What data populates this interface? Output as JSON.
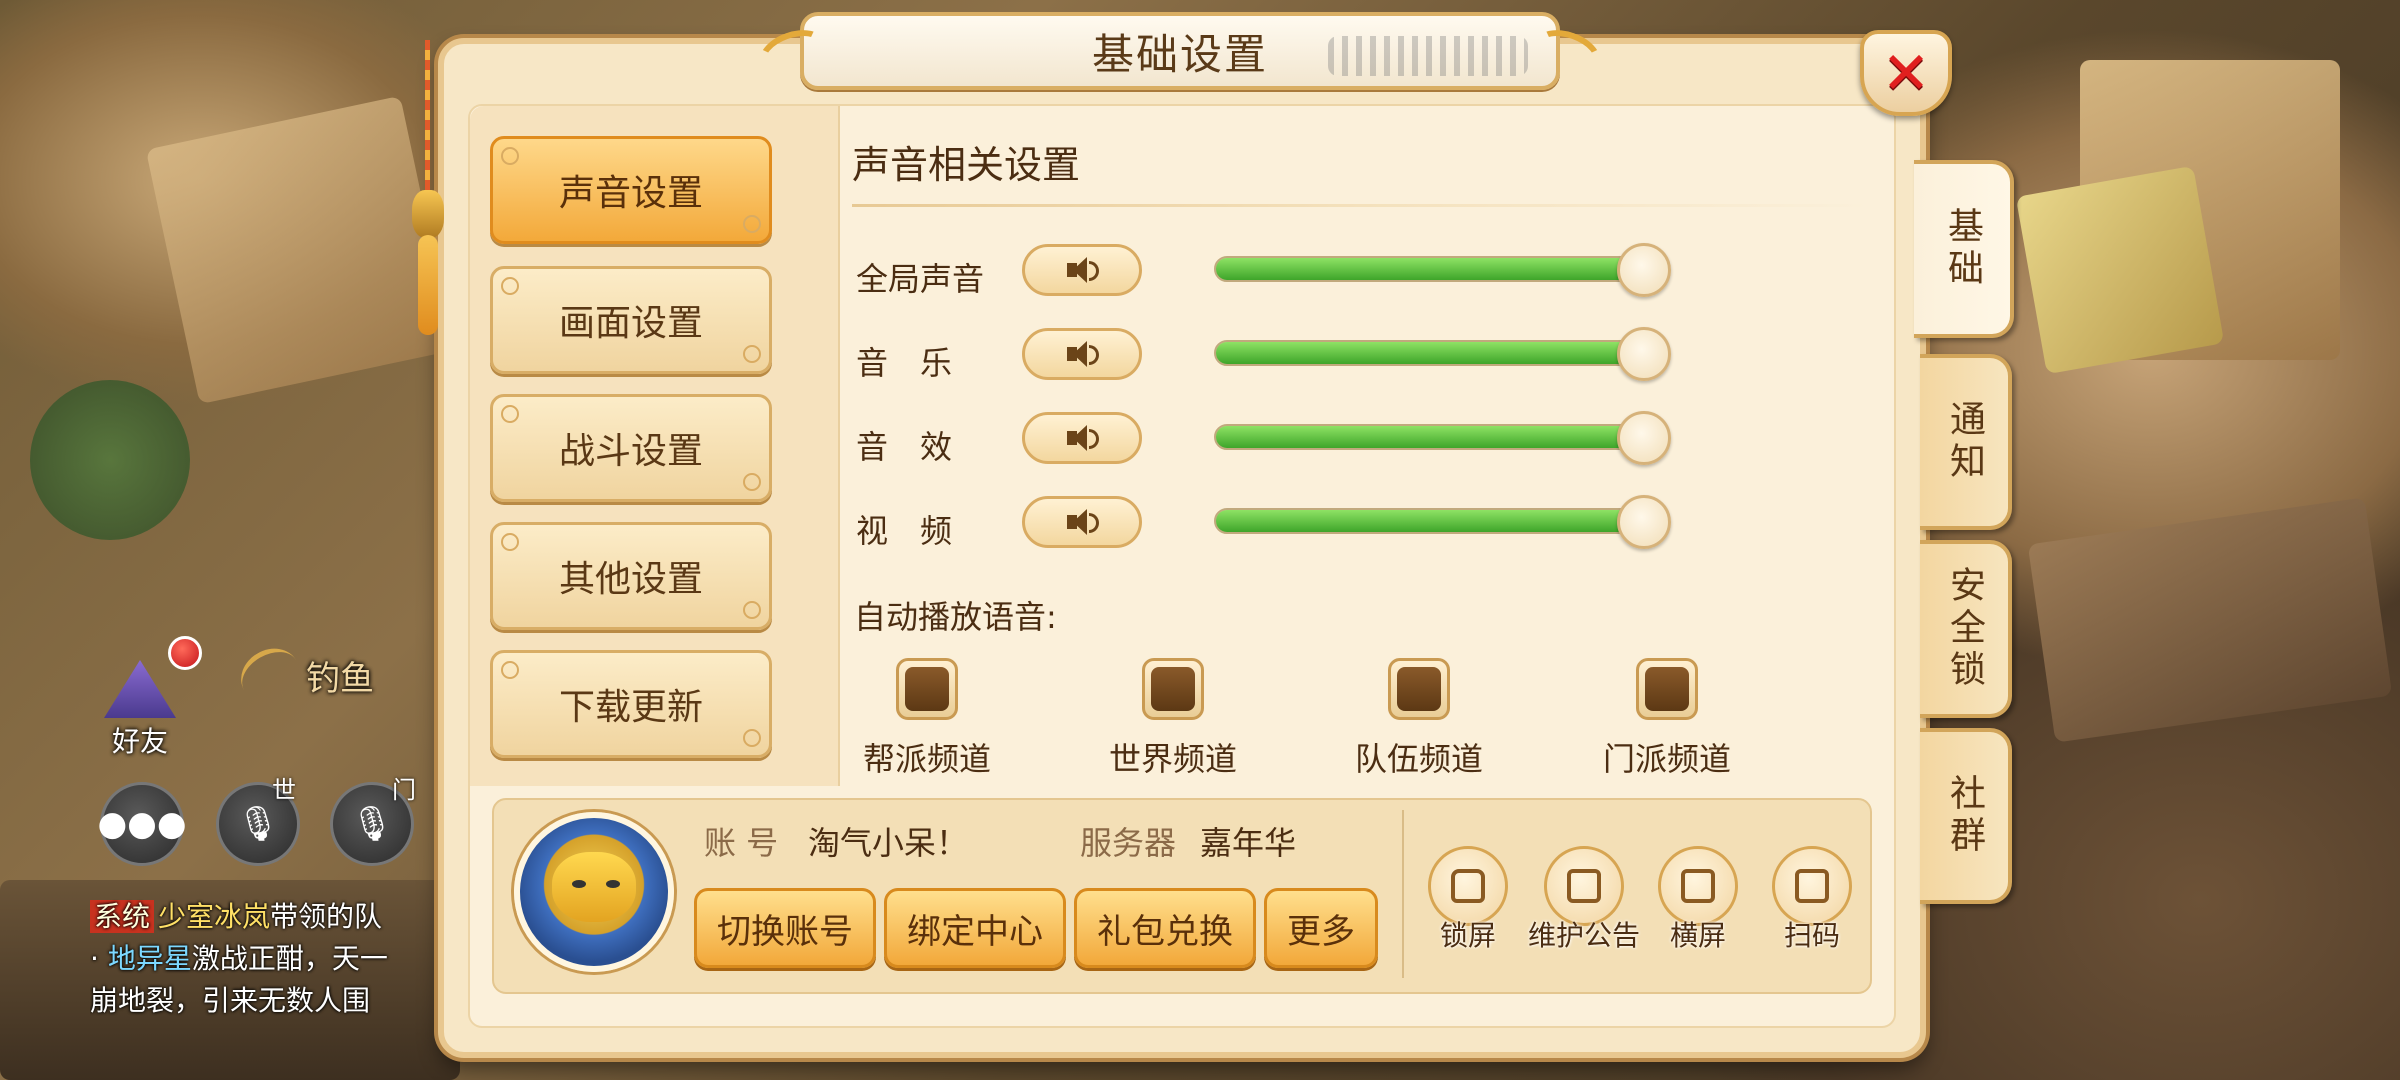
{
  "background": {
    "friend_label": "好友",
    "fishing_label": "钓鱼",
    "tag_world": "世",
    "tag_sect": "门",
    "chat_lines": [
      {
        "tag": "系统",
        "place": "少室冰岚",
        "text": "带领的队"
      },
      {
        "prefix": "· ",
        "highlight": "地异星",
        "text": "激战正酣，天一"
      },
      {
        "text": "崩地裂，引来无数人围"
      }
    ]
  },
  "dialog": {
    "title": "基础设置",
    "close_icon": "close-icon",
    "nav": [
      {
        "label": "声音设置",
        "active": true
      },
      {
        "label": "画面设置",
        "active": false
      },
      {
        "label": "战斗设置",
        "active": false
      },
      {
        "label": "其他设置",
        "active": false
      },
      {
        "label": "下载更新",
        "active": false
      }
    ],
    "side_tabs": [
      {
        "label": "基础",
        "active": true
      },
      {
        "label": "通知",
        "active": false
      },
      {
        "label": "安全锁",
        "active": false
      },
      {
        "label": "社群",
        "active": false
      }
    ],
    "sound": {
      "section_title": "声音相关设置",
      "rows": [
        {
          "label": "全局声音",
          "level": 1.0
        },
        {
          "label": "音　乐",
          "level": 1.0
        },
        {
          "label": "音　效",
          "level": 1.0
        },
        {
          "label": "视　频",
          "level": 1.0
        }
      ],
      "auto_voice_label": "自动播放语音:",
      "channels": [
        {
          "label": "帮派频道"
        },
        {
          "label": "世界频道"
        },
        {
          "label": "队伍频道"
        },
        {
          "label": "门派频道"
        }
      ]
    },
    "account": {
      "account_label": "账 号",
      "account_value": "淘气小呆！",
      "server_label": "服务器",
      "server_value": "嘉年华",
      "buttons": [
        "切换账号",
        "绑定中心",
        "礼包兑换",
        "更多"
      ],
      "quick": [
        {
          "label": "锁屏",
          "icon": "lock-icon"
        },
        {
          "label": "维护公告",
          "icon": "notice-icon"
        },
        {
          "label": "横屏",
          "icon": "rotate-icon"
        },
        {
          "label": "扫码",
          "icon": "scan-icon"
        }
      ]
    }
  },
  "colors": {
    "accent_orange": "#f3a93a",
    "slider_green": "#5cc23c",
    "close_red": "#e01f1f",
    "panel_bg": "#fbf0da"
  }
}
